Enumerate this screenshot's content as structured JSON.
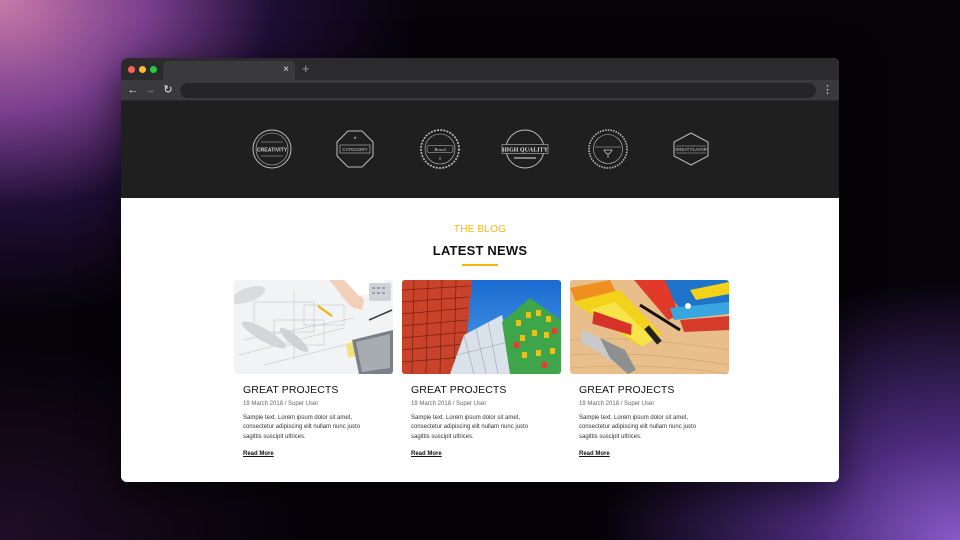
{
  "browser": {
    "tab_close_icon": "×",
    "new_tab_icon": "+",
    "back_icon": "←",
    "forward_icon": "→",
    "reload_icon": "↻",
    "menu_icon": "⋮"
  },
  "logos": [
    {
      "name": "creativity-badge-logo",
      "text": "CREATIVITY"
    },
    {
      "name": "octagon-badge-logo",
      "text": "CATEGORY"
    },
    {
      "name": "seal-badge-logo",
      "text": "Brand"
    },
    {
      "name": "high-quality-badge-logo",
      "text": "HIGH QUALITY"
    },
    {
      "name": "wine-badge-logo",
      "text": ""
    },
    {
      "name": "hexagon-badge-logo",
      "text": "GREAT FLAVOR"
    }
  ],
  "blog": {
    "eyebrow": "THE BLOG",
    "title": "LATEST NEWS",
    "accent_color": "#f2b707",
    "posts": [
      {
        "title": "GREAT PROJECTS",
        "meta": "19 March 2018 / Super User",
        "excerpt": "Sample text. Lorem ipsum dolor sit amet, consectetur adipiscing elit nullam nunc justo sagittis suscipit ultrices.",
        "link": "Read More",
        "image": "blueprint-drawing-photo"
      },
      {
        "title": "GREAT PROJECTS",
        "meta": "19 March 2018 / Super User",
        "excerpt": "Sample text. Lorem ipsum dolor sit amet, consectetur adipiscing elit nullam nunc justo sagittis suscipit ultrices.",
        "link": "Read More",
        "image": "colorful-buildings-photo"
      },
      {
        "title": "GREAT PROJECTS",
        "meta": "19 March 2018 / Super User",
        "excerpt": "Sample text. Lorem ipsum dolor sit amet, consectetur adipiscing elit nullam nunc justo sagittis suscipit ultrices.",
        "link": "Read More",
        "image": "tools-on-wood-photo"
      }
    ]
  }
}
